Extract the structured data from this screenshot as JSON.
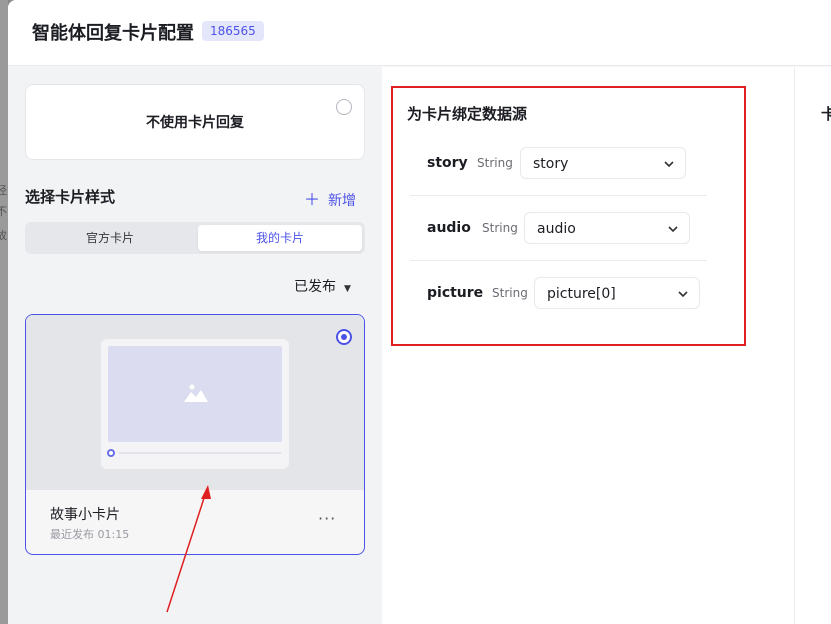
{
  "backdrop": {
    "fragments": [
      "径",
      "不",
      "故"
    ]
  },
  "header": {
    "title": "智能体回复卡片配置",
    "id_badge": "186565"
  },
  "left_panel": {
    "no_card_option": {
      "label": "不使用卡片回复",
      "selected": false
    },
    "section_title": "选择卡片样式",
    "add_button": {
      "icon": "plus-icon",
      "label": "新增"
    },
    "tabs": [
      {
        "label": "官方卡片",
        "active": false
      },
      {
        "label": "我的卡片",
        "active": true
      }
    ],
    "status_filter": {
      "label": "已发布",
      "icon": "caret-down-icon"
    },
    "cards": [
      {
        "name": "故事小卡片",
        "time": "最近发布 01:15",
        "selected": true,
        "more_icon": "more-icon",
        "more_label": "···"
      }
    ]
  },
  "bind_panel": {
    "title": "为卡片绑定数据源",
    "rows": [
      {
        "name": "story",
        "type": "String",
        "value": "story"
      },
      {
        "name": "audio",
        "type": "String",
        "value": "audio"
      },
      {
        "name": "picture",
        "type": "String",
        "value": "picture[0]"
      }
    ],
    "highlight_color": "#e02020"
  },
  "right_panel": {
    "title_peek": "卡"
  },
  "colors": {
    "accent": "#4d53e8",
    "annotation_red": "#e02020"
  }
}
